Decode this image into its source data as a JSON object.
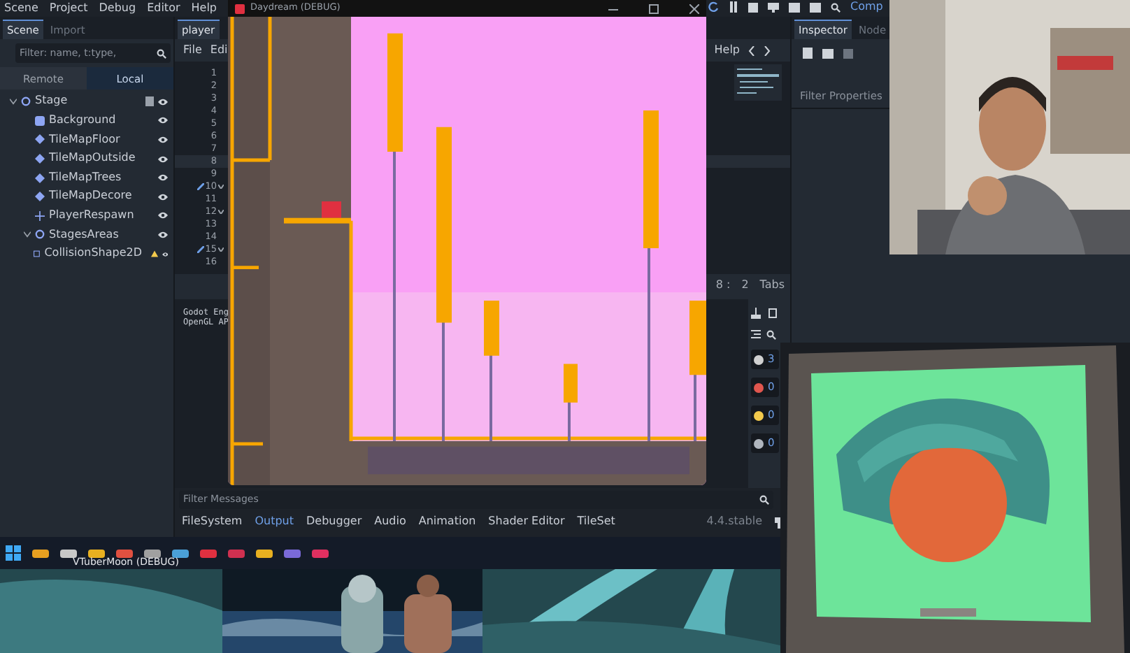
{
  "menu": [
    "Scene",
    "Project",
    "Debug",
    "Editor",
    "Help"
  ],
  "run_toolbar": {
    "label": "Comp"
  },
  "scene_dock": {
    "tabs": [
      {
        "label": "Scene",
        "selected": true
      },
      {
        "label": "Import",
        "selected": false
      }
    ],
    "filter": {
      "placeholder": "Filter: name, t:type,"
    },
    "modes": [
      {
        "label": "Remote",
        "selected": false
      },
      {
        "label": "Local",
        "selected": true
      }
    ],
    "tree": [
      {
        "label": "Stage",
        "kind": "node2d",
        "expanded": true,
        "script": true,
        "warning": false,
        "children": [
          {
            "label": "Background",
            "kind": "texture",
            "script": false,
            "warning": false
          },
          {
            "label": "TileMapFloor",
            "kind": "tilemap",
            "script": false,
            "warning": false
          },
          {
            "label": "TileMapOutside",
            "kind": "tilemap",
            "script": false,
            "warning": false
          },
          {
            "label": "TileMapTrees",
            "kind": "tilemap",
            "script": false,
            "warning": false
          },
          {
            "label": "TileMapDecore",
            "kind": "tilemap",
            "script": false,
            "warning": false
          },
          {
            "label": "PlayerRespawn",
            "kind": "marker",
            "script": false,
            "warning": false
          },
          {
            "label": "StagesAreas",
            "kind": "area",
            "expanded": true,
            "script": false,
            "warning": false,
            "children": [
              {
                "label": "CollisionShape2D",
                "kind": "shape",
                "script": false,
                "warning": true
              }
            ]
          }
        ]
      }
    ]
  },
  "script_editor": {
    "tab": "player",
    "menu": [
      "File",
      "Edi"
    ],
    "help": "Help",
    "lines": [
      {
        "text": "1",
        "current": false,
        "linked": false,
        "foldable": false
      },
      {
        "text": "2",
        "current": false,
        "linked": false,
        "foldable": false
      },
      {
        "text": "3",
        "current": false,
        "linked": false,
        "foldable": false
      },
      {
        "text": "4",
        "current": false,
        "linked": false,
        "foldable": false
      },
      {
        "text": "5",
        "current": false,
        "linked": false,
        "foldable": false
      },
      {
        "text": "6",
        "current": false,
        "linked": false,
        "foldable": false
      },
      {
        "text": "7",
        "current": false,
        "linked": false,
        "foldable": false
      },
      {
        "text": "8",
        "current": true,
        "linked": false,
        "foldable": false
      },
      {
        "text": "9",
        "current": false,
        "linked": false,
        "foldable": false
      },
      {
        "text": "10",
        "current": false,
        "linked": true,
        "foldable": true
      },
      {
        "text": "11",
        "current": false,
        "linked": false,
        "foldable": false
      },
      {
        "text": "12",
        "current": false,
        "linked": false,
        "foldable": true
      },
      {
        "text": "13",
        "current": false,
        "linked": false,
        "foldable": false
      },
      {
        "text": "14",
        "current": false,
        "linked": false,
        "foldable": false
      },
      {
        "text": "15",
        "current": false,
        "linked": true,
        "foldable": true
      },
      {
        "text": "16",
        "current": false,
        "linked": false,
        "foldable": false
      }
    ],
    "status": [
      "8 :",
      "2",
      "Tabs"
    ]
  },
  "output": {
    "lines": [
      "Godot Eng",
      "OpenGL AP"
    ],
    "filter": {
      "placeholder": "Filter Messages"
    },
    "counters": [
      {
        "kind": "info",
        "count": "3"
      },
      {
        "kind": "error",
        "count": "0"
      },
      {
        "kind": "warning",
        "count": "0"
      },
      {
        "kind": "message",
        "count": "0"
      }
    ]
  },
  "bottom_tabs": [
    {
      "label": "FileSystem",
      "selected": false
    },
    {
      "label": "Output",
      "selected": true
    },
    {
      "label": "Debugger",
      "selected": false
    },
    {
      "label": "Audio",
      "selected": false
    },
    {
      "label": "Animation",
      "selected": false
    },
    {
      "label": "Shader Editor",
      "selected": false
    },
    {
      "label": "TileSet",
      "selected": false
    }
  ],
  "version": "4.4.stable",
  "inspector": {
    "tabs": [
      {
        "label": "Inspector",
        "selected": true
      },
      {
        "label": "Node",
        "selected": false
      }
    ],
    "filter": {
      "placeholder": "Filter Properties"
    }
  },
  "game_window": {
    "title": "Daydream (DEBUG)"
  },
  "taskbar": {
    "window_label": "VTuberMoon (DEBUG)"
  }
}
